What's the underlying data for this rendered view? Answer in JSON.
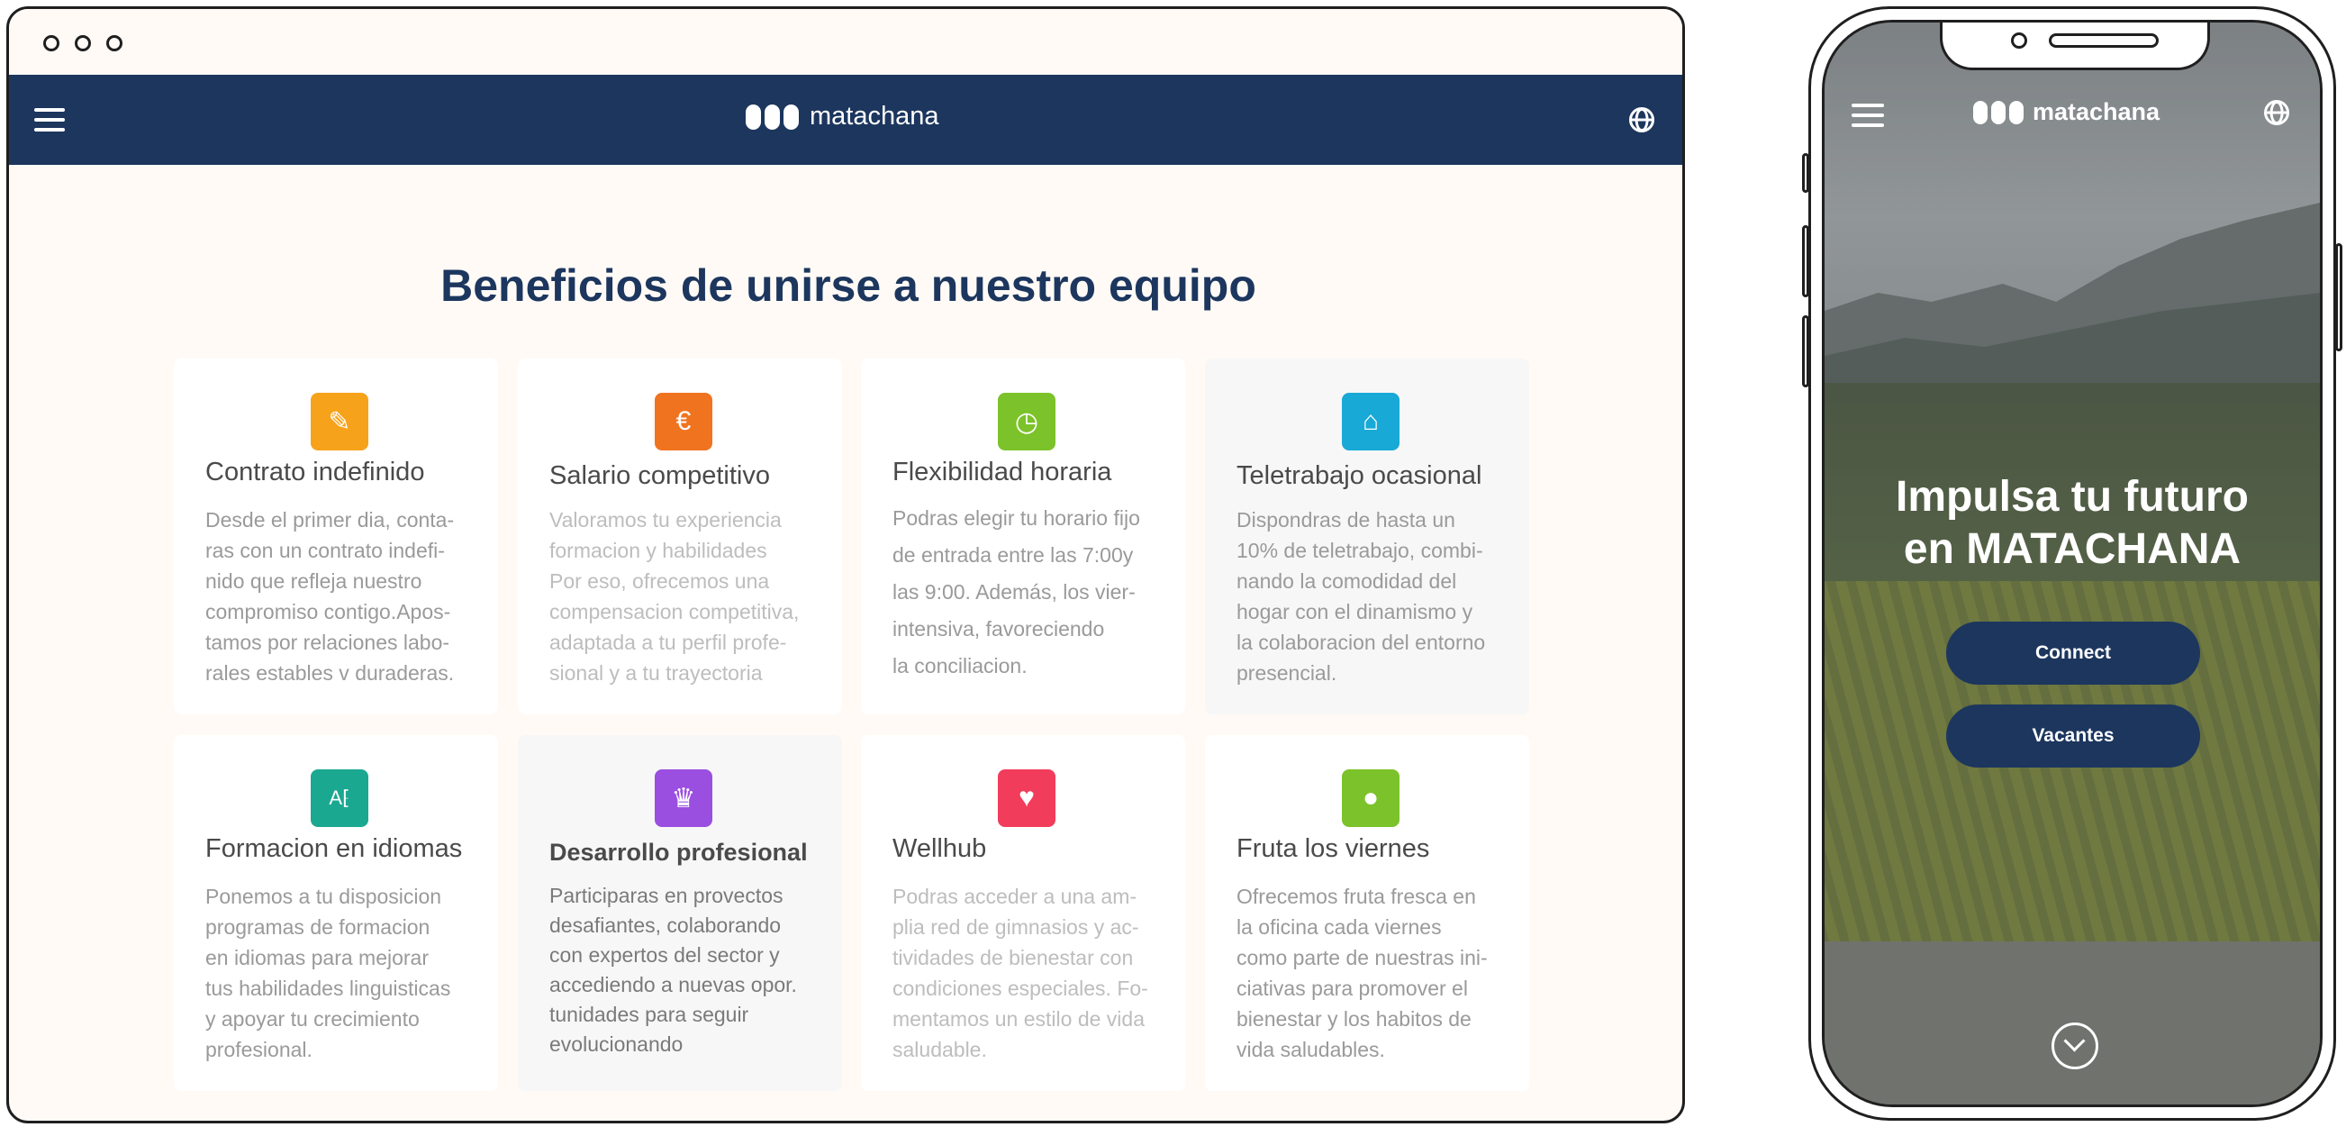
{
  "desktop": {
    "brand": "matachana",
    "heading": "Beneficios de unirse a nuestro equipo",
    "benefits": [
      {
        "title": "Contrato indefinido",
        "icon": "contract-icon",
        "color": "#f7a21b",
        "lines": [
          "Desde el primer dia, conta-",
          "ras con un contrato indefi-",
          "nido que refleja nuestro",
          "compromiso contigo.Apos-",
          "tamos por relaciones labo-",
          " rales estables v duraderas."
        ]
      },
      {
        "title": "Salario competitivo",
        "icon": "euro-icon",
        "color": "#f07320",
        "lines": [
          "Valoramos tu experiencia",
          "formacion y habilidades",
          "Por eso, ofrecemos una",
          "compensacion competitiva,",
          "adaptada a tu perfil profe-",
          "sional y a tu trayectoria"
        ]
      },
      {
        "title": "Flexibilidad horaria",
        "icon": "clock-icon",
        "color": "#7cc22a",
        "lines": [
          "Podras elegir tu horario fijo",
          "de entrada entre las 7:00y",
          " las 9:00. Además, los vier-",
          "intensiva, favoreciendo",
          "la conciliacion."
        ]
      },
      {
        "title": "Teletrabajo ocasional",
        "icon": "home-icon",
        "color": "#18a9d6",
        "lines": [
          "Dispondras de hasta un",
          "10% de teletrabajo, combi-",
          "nando la comodidad del",
          "hogar con el dinamismo y",
          "la colaboracion del entorno",
          "presencial."
        ]
      },
      {
        "title": "Formacion en idiomas",
        "icon": "language-icon",
        "color": "#1aa890",
        "lines": [
          "Ponemos a tu disposicion",
          " programas de formacion",
          "en idiomas para mejorar",
          "tus habilidades linguisticas",
          "y apoyar tu crecimiento",
          "profesional."
        ]
      },
      {
        "title": "Desarrollo profesional",
        "icon": "trophy-icon",
        "color": "#9b4fe0",
        "lines": [
          "Participaras en provectos",
          "desafiantes, colaborando",
          " con expertos del sector y",
          "accediendo a nuevas opor.",
          " tunidades para seguir",
          "evolucionando"
        ]
      },
      {
        "title": "Wellhub",
        "icon": "heartbeat-icon",
        "color": "#f23c5c",
        "lines": [
          "Podras acceder a una am-",
          " plia red de gimnasios y ac-",
          "tividades de bienestar con",
          " condiciones especiales. Fo-",
          "mentamos un estilo de vida",
          "saludable."
        ]
      },
      {
        "title": "Fruta los viernes",
        "icon": "apple-icon",
        "color": "#7cc22a",
        "lines": [
          "Ofrecemos fruta fresca en",
          "la oficina cada viernes",
          "como parte de nuestras ini-",
          "ciativas para promover el",
          "bienestar y los habitos de",
          "vida saludables."
        ]
      }
    ]
  },
  "mobile": {
    "brand": "matachana",
    "hero_line1": "Impulsa tu futuro",
    "hero_line2": "en MATACHANA",
    "connect_label": "Connect",
    "vacantes_label": "Vacantes"
  },
  "colors": {
    "navy": "#1c365e",
    "background": "#fffaf6"
  }
}
